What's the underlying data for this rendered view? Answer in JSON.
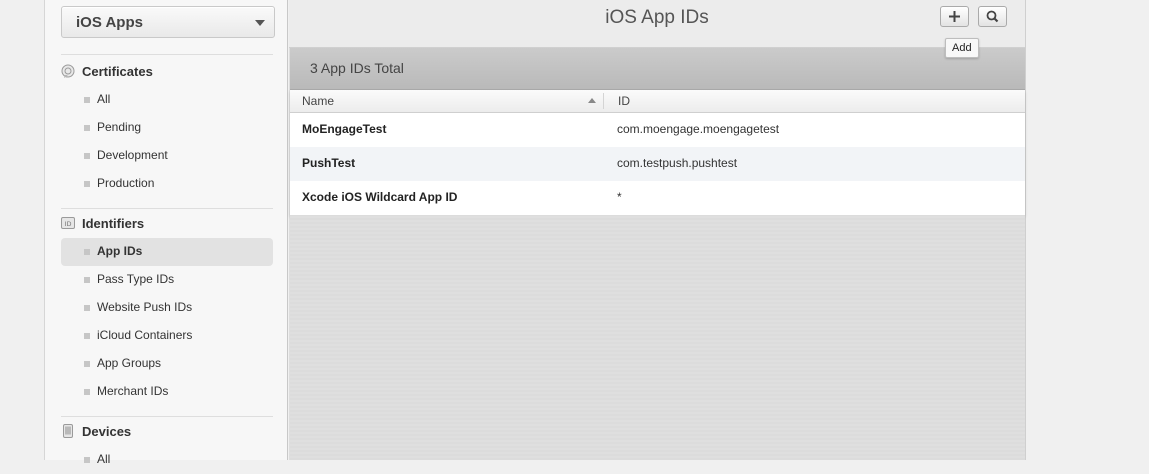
{
  "sidebar": {
    "platform": "iOS Apps",
    "sections": [
      {
        "title": "Certificates",
        "icon": "certificate-icon",
        "items": [
          {
            "label": "All"
          },
          {
            "label": "Pending"
          },
          {
            "label": "Development"
          },
          {
            "label": "Production"
          }
        ]
      },
      {
        "title": "Identifiers",
        "icon": "id-icon",
        "items": [
          {
            "label": "App IDs",
            "active": true
          },
          {
            "label": "Pass Type IDs"
          },
          {
            "label": "Website Push IDs"
          },
          {
            "label": "iCloud Containers"
          },
          {
            "label": "App Groups"
          },
          {
            "label": "Merchant IDs"
          }
        ]
      },
      {
        "title": "Devices",
        "icon": "device-icon",
        "items": [
          {
            "label": "All"
          }
        ]
      }
    ]
  },
  "header": {
    "title": "iOS App IDs",
    "add_icon": "plus-icon",
    "search_icon": "search-icon",
    "tooltip": "Add"
  },
  "summary": {
    "total_text": "3 App IDs Total"
  },
  "table": {
    "columns": [
      "Name",
      "ID"
    ],
    "sort_icon": "sort-ascending-icon",
    "rows": [
      {
        "name": "MoEngageTest",
        "id": "com.moengage.moengagetest"
      },
      {
        "name": "PushTest",
        "id": "com.testpush.pushtest"
      },
      {
        "name": "Xcode iOS Wildcard App ID",
        "id": "*"
      }
    ]
  },
  "colors": {
    "sidebar_bg": "#f7f7f7",
    "active_item_bg": "#e2e2e2",
    "header_bg": "#ececec",
    "total_bar_bg": "#c2c2c2",
    "alt_row_bg": "#f2f4f7"
  }
}
